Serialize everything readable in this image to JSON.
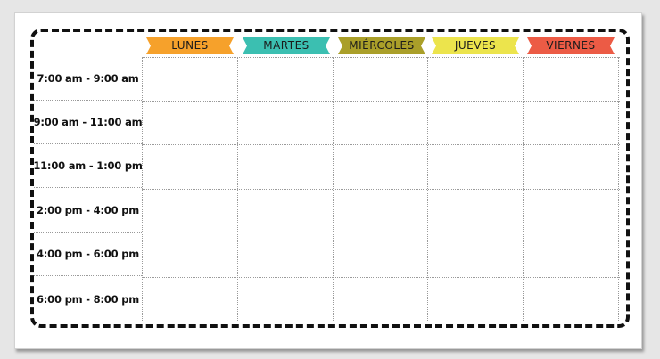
{
  "schedule": {
    "days": [
      {
        "label": "LUNES",
        "color": "#f6a12b"
      },
      {
        "label": "MARTES",
        "color": "#3bbfb1"
      },
      {
        "label": "MIÉRCOLES",
        "color": "#aa9f29"
      },
      {
        "label": "JUEVES",
        "color": "#ece44c"
      },
      {
        "label": "VIERNES",
        "color": "#ec5b45"
      }
    ],
    "time_slots": [
      {
        "label": "7:00 am - 9:00 am"
      },
      {
        "label": "9:00 am - 11:00 am"
      },
      {
        "label": "11:00 am - 1:00 pm"
      },
      {
        "label": "2:00 pm - 4:00 pm"
      },
      {
        "label": "4:00 pm - 6:00 pm"
      },
      {
        "label": "6:00 pm - 8:00 pm"
      }
    ]
  }
}
